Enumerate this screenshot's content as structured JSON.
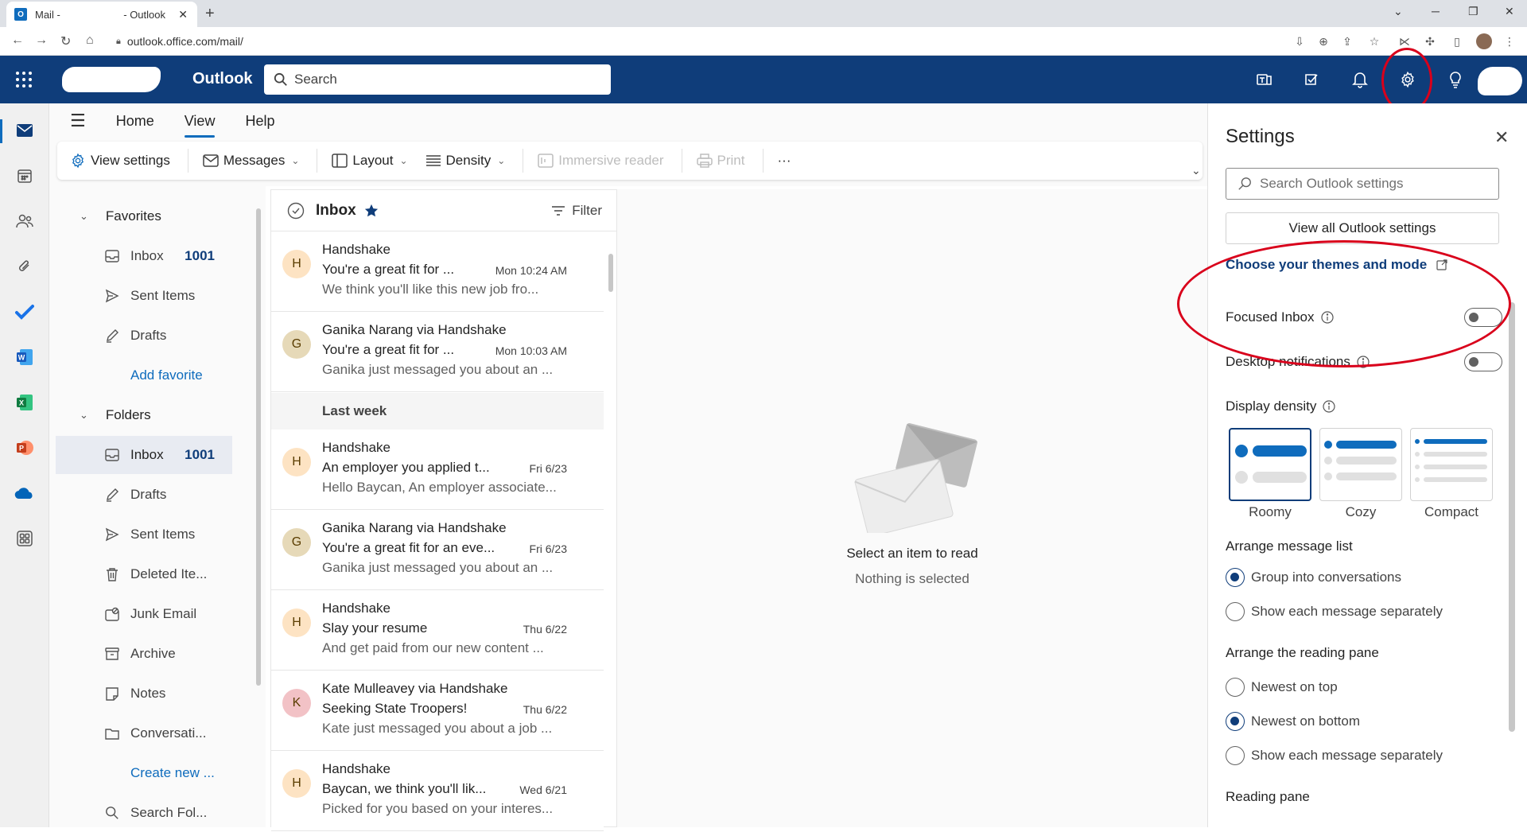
{
  "browser": {
    "tab_title_1": "Mail -",
    "tab_title_2": "- Outlook",
    "url": "outlook.office.com/mail/"
  },
  "header": {
    "brand": "Outlook",
    "search_placeholder": "Search"
  },
  "menu": {
    "tabs": [
      "Home",
      "View",
      "Help"
    ],
    "active_tab": "View"
  },
  "ribbon": {
    "view_settings": "View settings",
    "messages": "Messages",
    "layout": "Layout",
    "density": "Density",
    "immersive_reader": "Immersive reader",
    "print": "Print",
    "more": "···"
  },
  "folders": {
    "favorites_header": "Favorites",
    "favorites": [
      {
        "label": "Inbox",
        "count": "1001",
        "icon": "inbox-icon"
      },
      {
        "label": "Sent Items",
        "count": "",
        "icon": "send-icon"
      },
      {
        "label": "Drafts",
        "count": "",
        "icon": "pencil-icon"
      }
    ],
    "add_favorite": "Add favorite",
    "folders_header": "Folders",
    "items": [
      {
        "label": "Inbox",
        "count": "1001",
        "icon": "inbox-icon"
      },
      {
        "label": "Drafts",
        "count": "",
        "icon": "pencil-icon"
      },
      {
        "label": "Sent Items",
        "count": "",
        "icon": "send-icon"
      },
      {
        "label": "Deleted Ite...",
        "count": "",
        "icon": "trash-icon"
      },
      {
        "label": "Junk Email",
        "count": "",
        "icon": "junk-icon"
      },
      {
        "label": "Archive",
        "count": "",
        "icon": "archive-icon"
      },
      {
        "label": "Notes",
        "count": "",
        "icon": "note-icon"
      },
      {
        "label": "Conversati...",
        "count": "",
        "icon": "folder-icon"
      }
    ],
    "create_new": "Create new ...",
    "search_folders": "Search Fol..."
  },
  "message_list": {
    "title": "Inbox",
    "filter": "Filter",
    "group_last_week": "Last week",
    "messages": [
      {
        "initial": "H",
        "from": "Handshake",
        "subject": "You're a great fit for ...",
        "time": "Mon 10:24 AM",
        "preview": "We think you'll like this new job fro...",
        "color": "#fde3c3"
      },
      {
        "initial": "G",
        "from": "Ganika Narang via Handshake",
        "subject": "You're a great fit for ...",
        "time": "Mon 10:03 AM",
        "preview": "Ganika just messaged you about an ...",
        "color": "#e6d9b8"
      },
      {
        "initial": "H",
        "from": "Handshake",
        "subject": "An employer you applied t...",
        "time": "Fri 6/23",
        "preview": "Hello Baycan, An employer associate...",
        "color": "#fde3c3"
      },
      {
        "initial": "G",
        "from": "Ganika Narang via Handshake",
        "subject": "You're a great fit for an eve...",
        "time": "Fri 6/23",
        "preview": "Ganika just messaged you about an ...",
        "color": "#e6d9b8"
      },
      {
        "initial": "H",
        "from": "Handshake",
        "subject": "Slay your resume",
        "time": "Thu 6/22",
        "preview": "And get paid from our new content ...",
        "color": "#fde3c3"
      },
      {
        "initial": "K",
        "from": "Kate Mulleavey via Handshake",
        "subject": "Seeking State Troopers!",
        "time": "Thu 6/22",
        "preview": "Kate just messaged you about a job ...",
        "color": "#f2c2c6"
      },
      {
        "initial": "H",
        "from": "Handshake",
        "subject": "Baycan, we think you'll lik...",
        "time": "Wed 6/21",
        "preview": "Picked for you based on your interes...",
        "color": "#fde3c3"
      }
    ]
  },
  "reading_pane": {
    "title": "Select an item to read",
    "subtitle": "Nothing is selected"
  },
  "settings": {
    "title": "Settings",
    "search_placeholder": "Search Outlook settings",
    "view_all": "View all Outlook settings",
    "themes_link": "Choose your themes and mode",
    "focused_inbox": "Focused Inbox",
    "focused_inbox_on": false,
    "desktop_notifications": "Desktop notifications",
    "desktop_notifications_on": false,
    "display_density": "Display density",
    "density_options": [
      "Roomy",
      "Cozy",
      "Compact"
    ],
    "density_selected": "Roomy",
    "arrange_list": "Arrange message list",
    "arrange_list_options": [
      "Group into conversations",
      "Show each message separately"
    ],
    "arrange_list_selected": "Group into conversations",
    "arrange_reading": "Arrange the reading pane",
    "arrange_reading_options": [
      "Newest on top",
      "Newest on bottom",
      "Show each message separately"
    ],
    "arrange_reading_selected": "Newest on bottom",
    "reading_pane": "Reading pane"
  },
  "colors": {
    "header_bg": "#0f3d7a",
    "accent": "#0f6cbd",
    "annotation": "#d9001b"
  }
}
